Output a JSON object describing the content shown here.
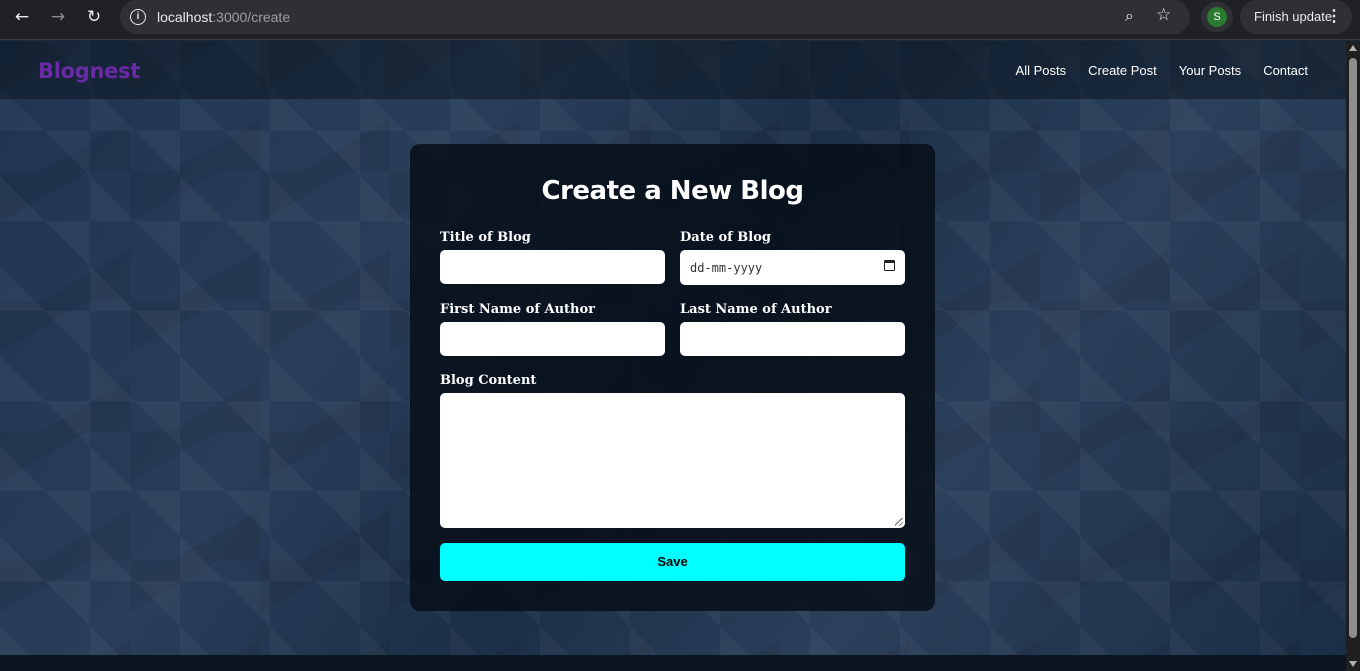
{
  "browser": {
    "url_host": "localhost",
    "url_path": ":3000/create",
    "profile_initial": "S",
    "update_label": "Finish update",
    "icons": [
      "back-arrow-icon",
      "forward-arrow-icon",
      "reload-icon",
      "site-info-icon",
      "zoom-icon",
      "bookmark-star-icon",
      "more-vert-icon"
    ]
  },
  "site": {
    "logo": "Blognest",
    "logo_color": "#6a2aa6",
    "nav": [
      "All Posts",
      "Create Post",
      "Your Posts",
      "Contact"
    ]
  },
  "form": {
    "heading": "Create a New Blog",
    "title_label": "Title of Blog",
    "title_value": "",
    "date_label": "Date of Blog",
    "date_placeholder": "dd-mm-yyyy",
    "first_name_label": "First Name of Author",
    "first_name_value": "",
    "last_name_label": "Last Name of Author",
    "last_name_value": "",
    "content_label": "Blog Content",
    "content_value": "",
    "save_label": "Save",
    "save_color": "#00ffff"
  }
}
